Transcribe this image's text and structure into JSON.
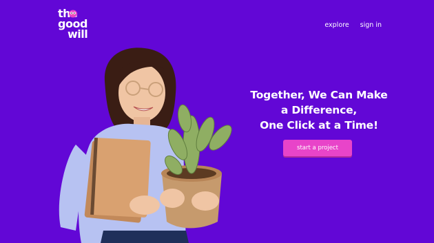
{
  "brand": {
    "line1": "the",
    "line2": "good",
    "line3": "will"
  },
  "nav": {
    "explore": "explore",
    "sign_in": "sign in"
  },
  "hero": {
    "line1": "Together, We Can Make",
    "line2": "a Difference,",
    "line3": "One Click at a Time!",
    "cta": "start a project"
  },
  "colors": {
    "background": "#6207d6",
    "accent": "#e844c9"
  }
}
